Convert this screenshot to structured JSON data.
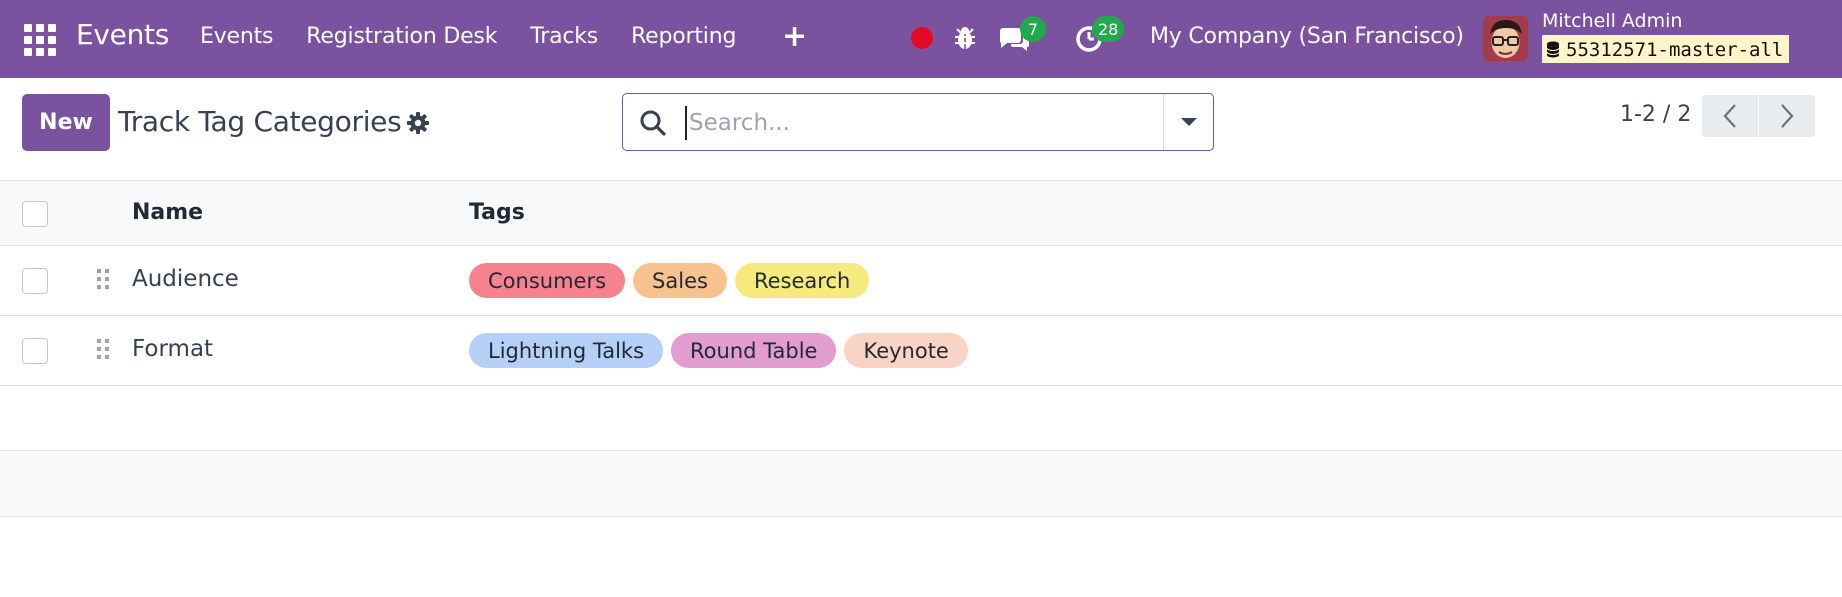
{
  "navbar": {
    "app_name": "Events",
    "menu": [
      "Events",
      "Registration Desk",
      "Tracks",
      "Reporting"
    ],
    "plus_label": "+",
    "messages_count": "7",
    "activities_count": "28",
    "company": "My Company (San Francisco)",
    "user_name": "Mitchell Admin",
    "database": "55312571-master-all",
    "colors": {
      "bar": "#7b529f",
      "record": "#e30a26",
      "badge": "#22a94d",
      "db_tag_bg": "#fff5c9"
    }
  },
  "control_panel": {
    "new_label": "New",
    "title": "Track Tag Categories",
    "search_placeholder": "Search...",
    "pager": "1-2 / 2"
  },
  "list": {
    "columns": [
      "Name",
      "Tags"
    ],
    "rows": [
      {
        "name": "Audience",
        "tags": [
          {
            "label": "Consumers",
            "color": "#f5828d"
          },
          {
            "label": "Sales",
            "color": "#f7c28d"
          },
          {
            "label": "Research",
            "color": "#f7ea7d"
          }
        ]
      },
      {
        "name": "Format",
        "tags": [
          {
            "label": "Lightning Talks",
            "color": "#b6cff7"
          },
          {
            "label": "Round Table",
            "color": "#e29cd0"
          },
          {
            "label": "Keynote",
            "color": "#f9d3c3"
          }
        ]
      }
    ]
  }
}
